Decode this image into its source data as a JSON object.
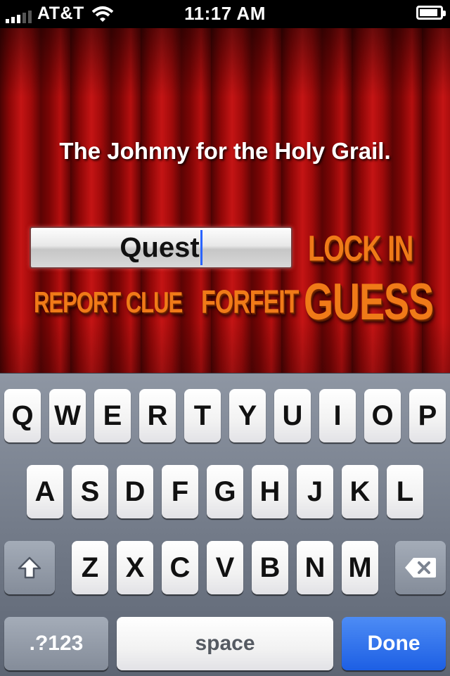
{
  "status_bar": {
    "carrier": "AT&T",
    "time": "11:17 AM",
    "battery_level": 0.9
  },
  "clue": {
    "text": "The Johnny for the Holy Grail."
  },
  "guess_input": {
    "value": "Quest"
  },
  "actions": {
    "lock_in": "LOCK IN",
    "report_clue": "REPORT CLUE",
    "forfeit": "FORFEIT",
    "guess": "GUESS"
  },
  "keyboard": {
    "row1": [
      "Q",
      "W",
      "E",
      "R",
      "T",
      "Y",
      "U",
      "I",
      "O",
      "P"
    ],
    "row2": [
      "A",
      "S",
      "D",
      "F",
      "G",
      "H",
      "J",
      "K",
      "L"
    ],
    "row3": [
      "Z",
      "X",
      "C",
      "V",
      "B",
      "N",
      "M"
    ],
    "numbers_label": ".?123",
    "space_label": "space",
    "done_label": "Done"
  }
}
